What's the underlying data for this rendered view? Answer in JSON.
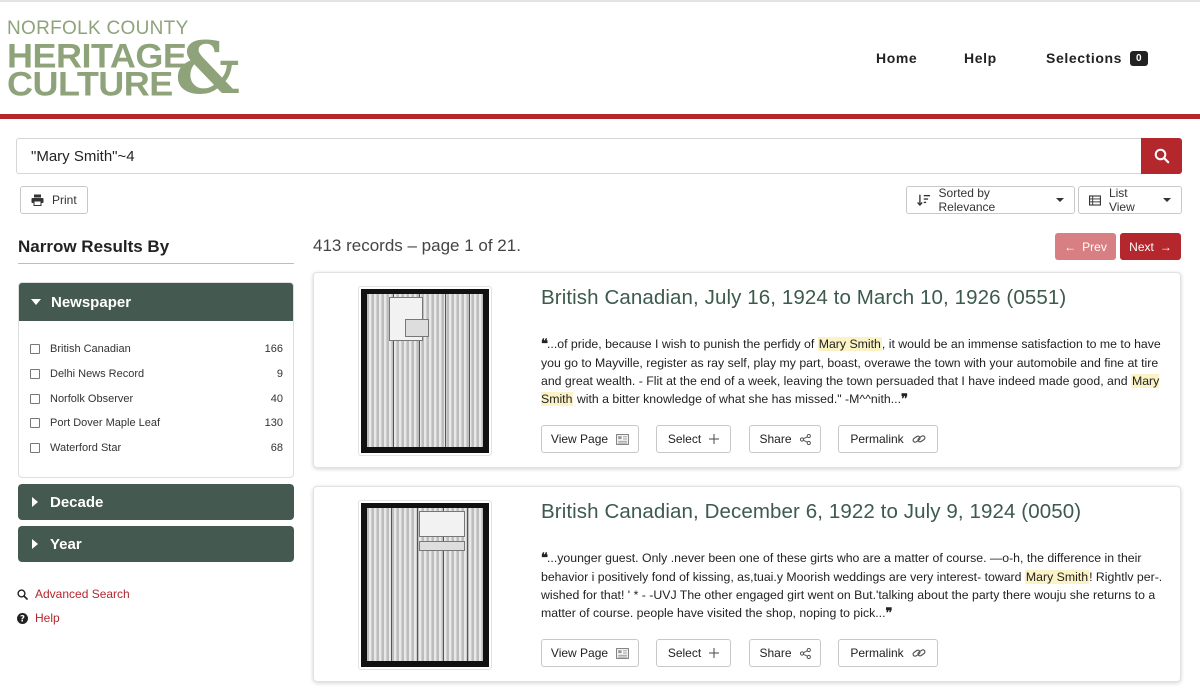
{
  "header": {
    "logo_line1": "NORFOLK COUNTY",
    "logo_line2": "HERITAGE",
    "logo_line3": "CULTURE",
    "logo_amp": "&",
    "nav": {
      "home": "Home",
      "help": "Help",
      "selections": "Selections",
      "selections_count": "0"
    }
  },
  "colors": {
    "brand_red": "#b3272d",
    "facet_green": "#44594f",
    "logo_green": "#8ea37a",
    "highlight": "#fbf2c5"
  },
  "search": {
    "value": "\"Mary Smith\"~4",
    "button_icon": "search-icon"
  },
  "toolbar": {
    "print_label": "Print",
    "sort_label": "Sorted by Relevance",
    "view_label": "List View"
  },
  "sidebar": {
    "title": "Narrow Results By",
    "facets": {
      "newspaper": {
        "label": "Newspaper",
        "items": [
          {
            "label": "British Canadian",
            "count": "166"
          },
          {
            "label": "Delhi News Record",
            "count": "9"
          },
          {
            "label": "Norfolk Observer",
            "count": "40"
          },
          {
            "label": "Port Dover Maple Leaf",
            "count": "130"
          },
          {
            "label": "Waterford Star",
            "count": "68"
          }
        ]
      },
      "decade": {
        "label": "Decade"
      },
      "year": {
        "label": "Year"
      }
    },
    "links": {
      "advanced": "Advanced Search",
      "help": "Help"
    }
  },
  "results": {
    "summary": "413 records – page 1 of 21.",
    "prev_label": "Prev",
    "next_label": "Next",
    "items": [
      {
        "title": "British Canadian, July 16, 1924 to March 10, 1926 (0551)",
        "snippet": [
          {
            "t": "...of pride, because I wish to punish the perfidy of ",
            "hl": false
          },
          {
            "t": "Mary Smith",
            "hl": true
          },
          {
            "t": ", it would be an immense satisfaction to me to have you go to Mayville, register as ray self, play my part, boast, overawe the town with your automobile and fine at tire and great wealth. - Flit at the end of a week, leaving the town persuaded that I have indeed made good, and ",
            "hl": false
          },
          {
            "t": "Mary Smith",
            "hl": true
          },
          {
            "t": " with a bitter knowledge of what she has missed.\" -M^^nith...",
            "hl": false
          }
        ]
      },
      {
        "title": "British Canadian, December 6, 1922 to July 9, 1924 (0050)",
        "snippet": [
          {
            "t": "...younger guest. Only .never been one of these girts who are a matter of course. —o-h, the difference in their behavior i positively fond of kissing, as,tuai.y Moorish weddings are very interest- toward ",
            "hl": false
          },
          {
            "t": "Mary Smith",
            "hl": true
          },
          {
            "t": "! Rightlv per-. wished for that! ' * - -UVJ The other engaged girt went on But.'talking about the party there wouju she returns to a matter of course. people have visited the shop, noping to pick...",
            "hl": false
          }
        ]
      }
    ],
    "actions": {
      "view_page": "View Page",
      "select": "Select",
      "share": "Share",
      "permalink": "Permalink"
    }
  }
}
